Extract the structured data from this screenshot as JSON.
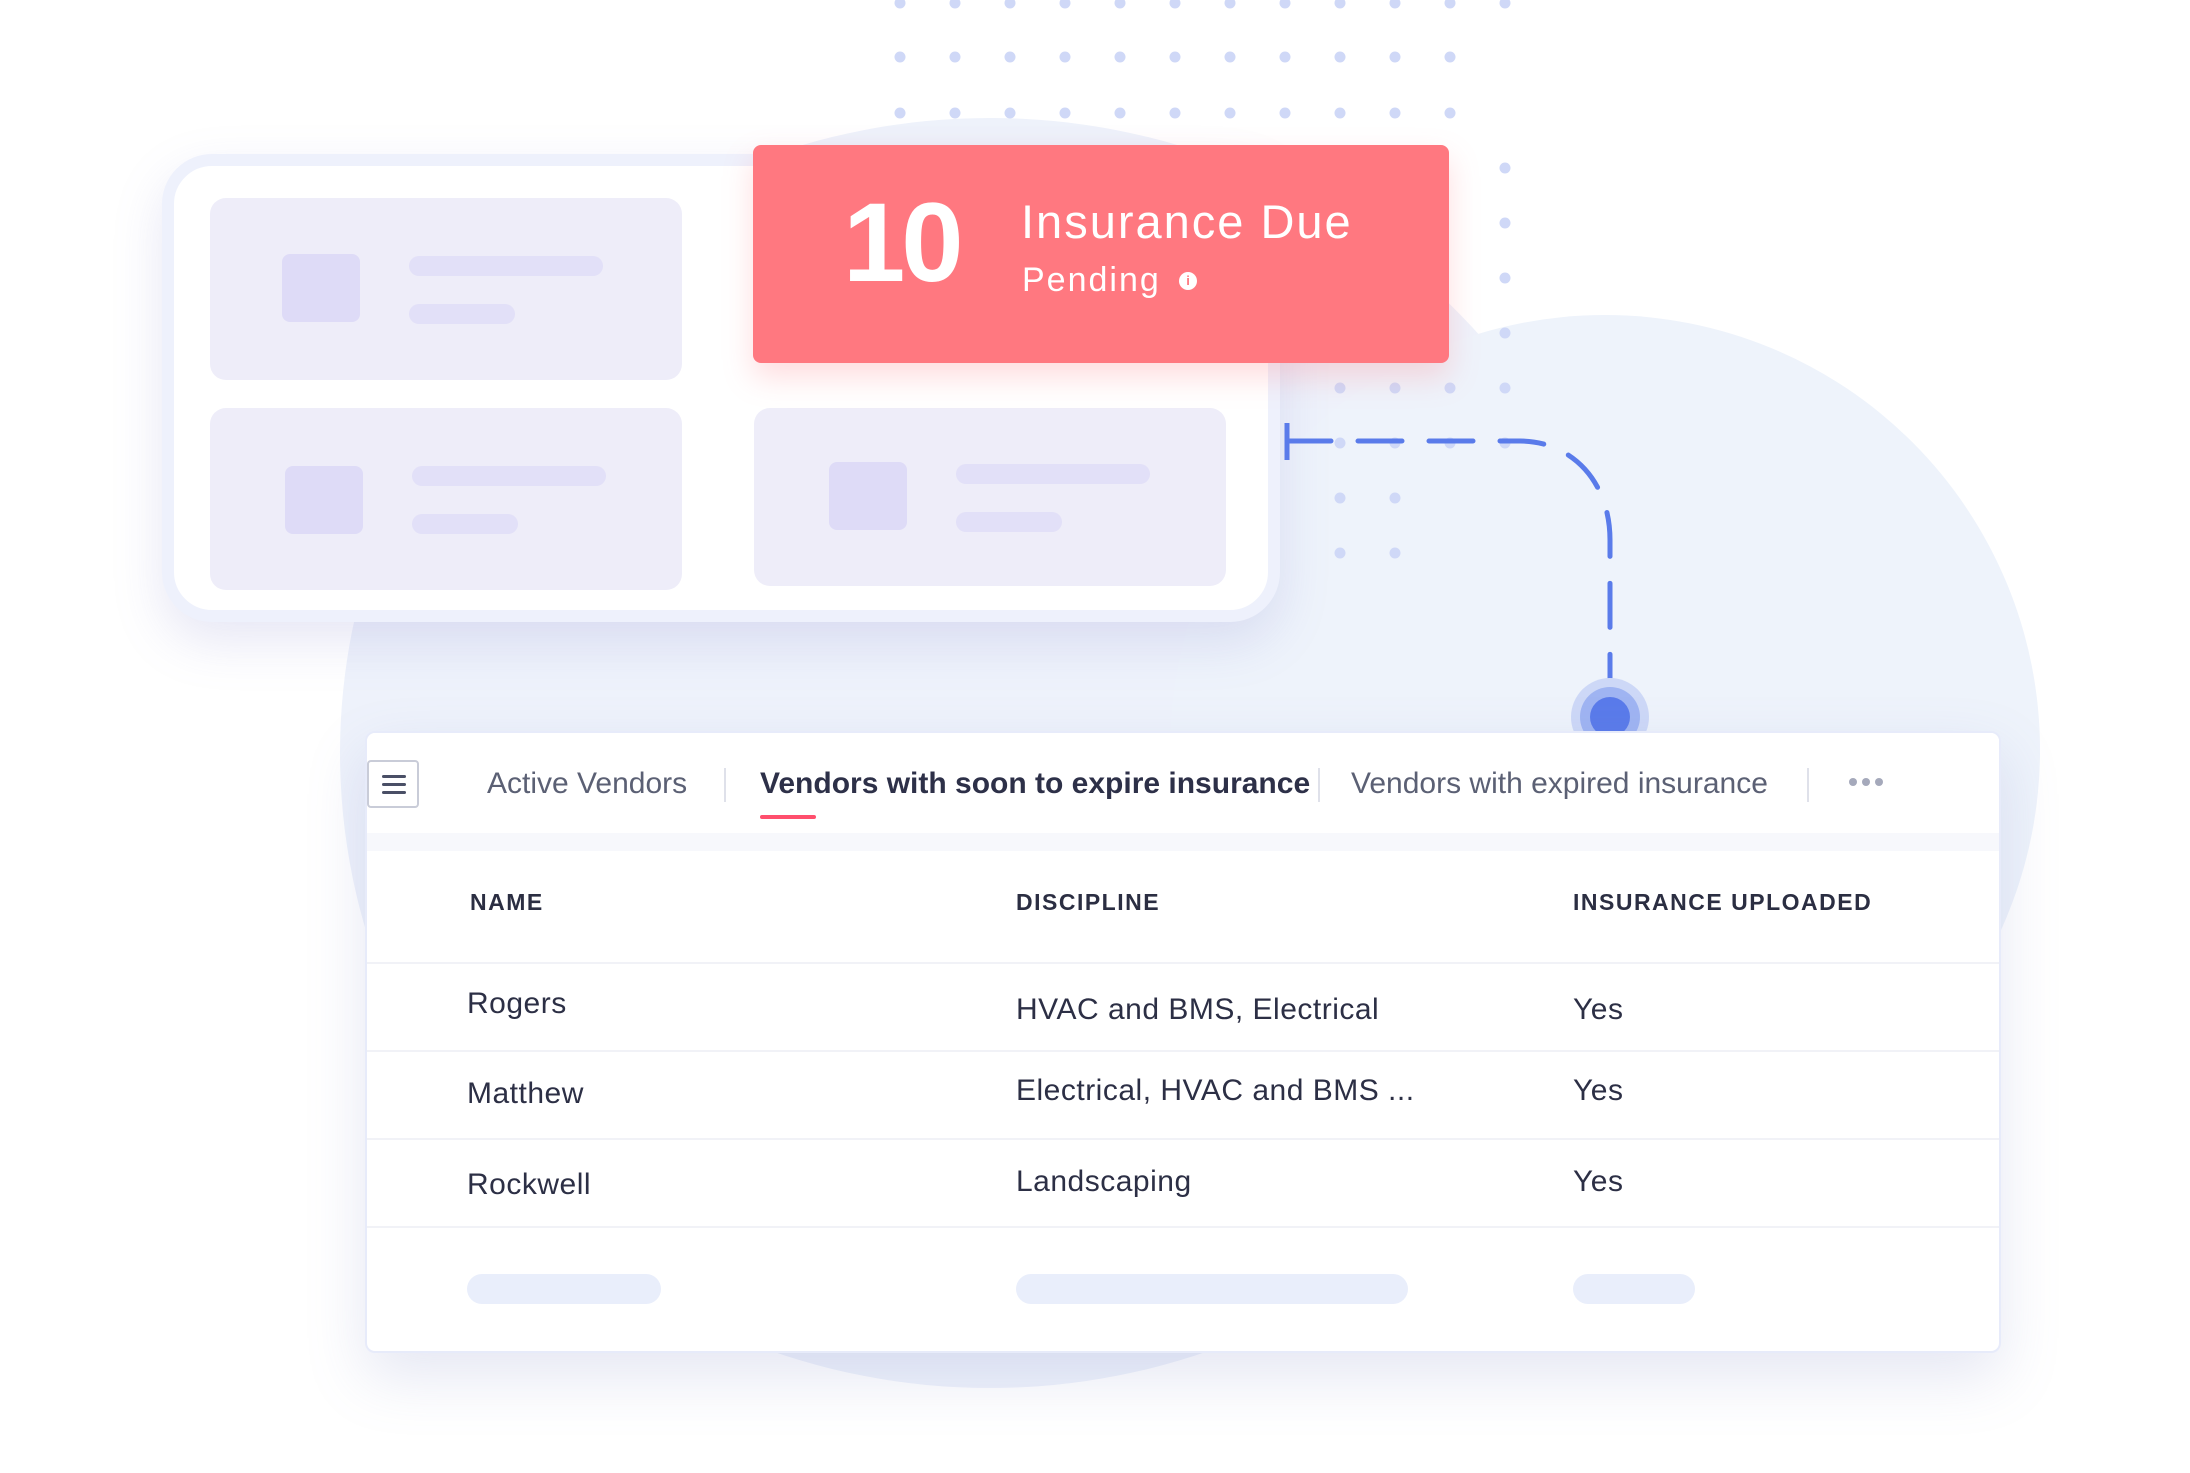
{
  "alert": {
    "count": "10",
    "title": "Insurance Due",
    "status": "Pending",
    "info_icon": "i",
    "color": "#ff7880"
  },
  "tabs": [
    {
      "label": "Active Vendors",
      "active": false
    },
    {
      "label": "Vendors with soon to expire insurance",
      "active": true
    },
    {
      "label": "Vendors with expired insurance",
      "active": false
    }
  ],
  "table": {
    "columns": [
      "NAME",
      "DISCIPLINE",
      "INSURANCE UPLOADED"
    ],
    "rows": [
      {
        "name": "Rogers",
        "discipline": "HVAC and BMS, Electrical",
        "insurance": "Yes"
      },
      {
        "name": "Matthew",
        "discipline": "Electrical, HVAC and BMS ...",
        "insurance": "Yes"
      },
      {
        "name": "Rockwell",
        "discipline": "Landscaping",
        "insurance": "Yes"
      }
    ]
  },
  "colors": {
    "accent": "#5a7bea",
    "tab_underline": "#ff4f6d",
    "background_blob": "#eef2fb"
  }
}
